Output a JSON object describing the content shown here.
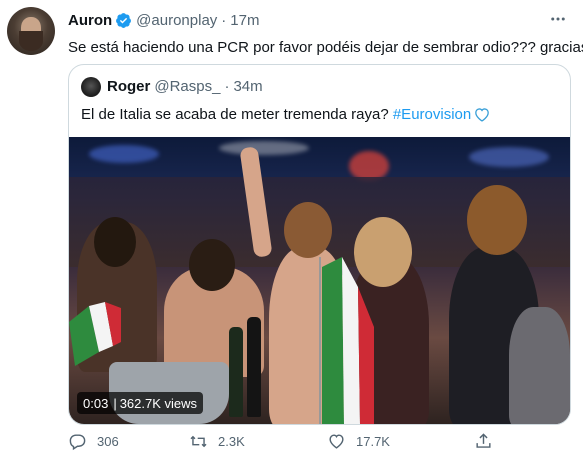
{
  "tweet": {
    "author_name": "Auron",
    "handle": "@auronplay",
    "separator": "·",
    "time": "17m",
    "text": "Se está haciendo una PCR por favor podéis dejar de sembrar odio??? gracias"
  },
  "quoted": {
    "author_name": "Roger",
    "handle": "@Rasps_",
    "separator": "·",
    "time": "34m",
    "text_before": "El de Italia se acaba de meter tremenda raya? ",
    "hashtag": "#Eurovision",
    "video": {
      "current_time": "0:03",
      "views": "362.7K views"
    }
  },
  "actions": {
    "reply_count": "306",
    "retweet_count": "2.3K",
    "like_count": "17.7K"
  },
  "colors": {
    "verified": "#1d9bf0",
    "hashtag": "#1d9bf0",
    "secondary_text": "#536471",
    "border": "#cfd9de",
    "heart_outline": "#3aa0d8"
  },
  "icons": [
    "verified-badge-icon",
    "more-icon",
    "blue-heart-icon",
    "reply-icon",
    "retweet-icon",
    "like-icon",
    "share-icon"
  ]
}
